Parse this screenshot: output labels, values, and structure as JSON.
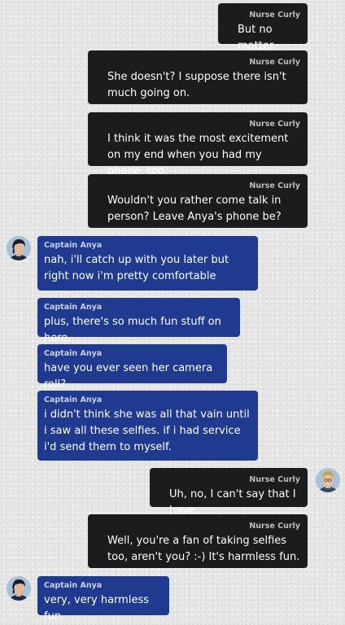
{
  "contacts": {
    "self_name": "Nurse Curly",
    "other_name": "Captain Anya"
  },
  "messages": [
    {
      "sender": "Nurse Curly",
      "text": "But no matter."
    },
    {
      "sender": "Nurse Curly",
      "text": "She doesn't? I suppose there isn't much going on."
    },
    {
      "sender": "Nurse Curly",
      "text": "I think it was the most excitement on my end when you had my phone, too."
    },
    {
      "sender": "Nurse Curly",
      "text": "Wouldn't you rather come talk in person? Leave Anya's phone be?"
    },
    {
      "sender": "Captain Anya",
      "text": "nah, i'll catch up with you later but right now i'm pretty comfortable"
    },
    {
      "sender": "Captain Anya",
      "text": "plus, there's so much fun stuff on here."
    },
    {
      "sender": "Captain Anya",
      "text": "have you ever seen her camera roll?"
    },
    {
      "sender": "Captain Anya",
      "text": "i didn't think she was all that vain until i saw all these selfies. if i had service i'd send them to myself."
    },
    {
      "sender": "Nurse Curly",
      "text": "Uh, no, I can't say that I have."
    },
    {
      "sender": "Nurse Curly",
      "text": "Well, you're a fan of taking selfies too, aren't you? :-) It's harmless fun."
    },
    {
      "sender": "Captain Anya",
      "text": "very, very harmless fun."
    }
  ],
  "colors": {
    "outgoing_bubble": "#1c1c1f",
    "incoming_bubble": "#203a8f",
    "background": "#e6e6e6"
  },
  "icons": {
    "anya_avatar": "anya-avatar-icon",
    "curly_avatar": "curly-avatar-icon"
  }
}
